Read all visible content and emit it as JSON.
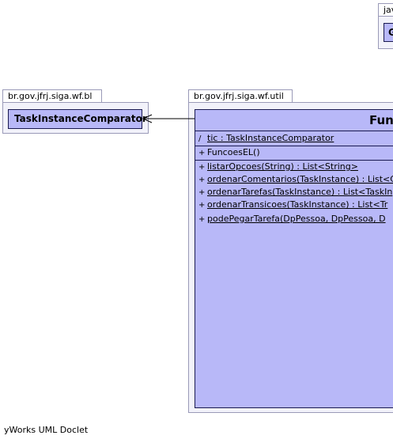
{
  "diagram": {
    "packages": [
      {
        "id": "pkg-java",
        "name": "jav"
      },
      {
        "id": "pkg-bl",
        "name": "br.gov.jfrj.siga.wf.bl"
      },
      {
        "id": "pkg-util",
        "name": "br.gov.jfrj.siga.wf.util"
      }
    ],
    "classes": {
      "top_right": {
        "name": "G"
      },
      "comparator": {
        "name": "TaskInstanceComparator"
      },
      "funcoes": {
        "name": "Func",
        "attributes": [
          {
            "visibility": "/",
            "text": "tic : TaskInstanceComparator",
            "static": true
          }
        ],
        "constructors": [
          {
            "visibility": "+",
            "text": "FuncoesEL()",
            "static": false
          }
        ],
        "methods": [
          {
            "visibility": "+",
            "text": "listarOpcoes(String) : List<String>",
            "static": true
          },
          {
            "visibility": "+",
            "text": "ordenarComentarios(TaskInstance) : List<C",
            "static": true
          },
          {
            "visibility": "+",
            "text": "ordenarTarefas(TaskInstance) : List<TaskIn",
            "static": true
          },
          {
            "visibility": "+",
            "text": "ordenarTransicoes(TaskInstance) : List<Tr",
            "static": true
          },
          {
            "visibility": "+",
            "text": "podePegarTarefa(DpPessoa, DpPessoa, D",
            "static": true
          }
        ]
      }
    },
    "relation": {
      "from": "funcoes",
      "to": "comparator",
      "kind": "navigable-association"
    },
    "footer": "yWorks UML Doclet"
  }
}
